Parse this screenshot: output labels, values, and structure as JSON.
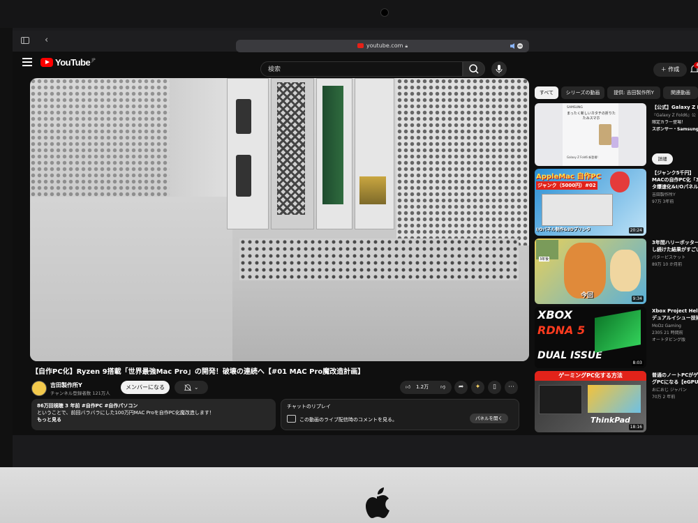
{
  "browser": {
    "url": "youtube.com"
  },
  "header": {
    "logo_text": "YouTube",
    "logo_sup": "JP",
    "search_placeholder": "検索",
    "create_label": "作成",
    "notification_count": "4"
  },
  "video": {
    "title": "【自作PC化】Ryzen 9搭載「世界最強Mac Pro」の開発！破壊の連続へ【#01 MAC Pro魔改造計画】",
    "channel_name": "吉田製作所Y",
    "subscribers": "チャンネル登録者数 121万人",
    "member_button": "メンバーになる",
    "like_count": "1.2万"
  },
  "description": {
    "stats": "86万回視聴  3 年前  #自作PC #自作パソコン",
    "line1": "ということで、前回バラバラにした100万円MAC Proを自作PC化魔改造します！",
    "more": "もっと見る"
  },
  "chat_replay": {
    "title": "チャットのリプレイ",
    "text": "この動画のライブ配信時のコメントを見る。",
    "open_button": "パネルを開く"
  },
  "sidebar": {
    "chips": [
      "すべて",
      "シリーズの動画",
      "提供: 吉田製作所Y",
      "関連動画"
    ],
    "recommendations": [
      {
        "title1": "【公式】Galaxy Z F",
        "title2": "『Galaxy Z Fold6』公",
        "meta1": "限定カラー登場！",
        "meta2": "スポンサー・Samsung",
        "thumb_text1": "SAMSUNG",
        "thumb_text2": "まったく新しいカタチの折りたたみスマホ",
        "thumb_text3": "Galaxy Z Fold6 新登場!",
        "action": "詳細"
      },
      {
        "title1": "【ジャンク5千円】",
        "title2": "MACの自作PC化「3",
        "meta1": "タ爆速化&I/Oパネル",
        "meta2": "吉田製作所Y",
        "meta3": "97万 3年前",
        "thumb_text1": "AppleMac 自作PC",
        "thumb_text2": "ジャンク（5000円）#02",
        "thumb_text3": "I/Oパネル制作&3Dプリンタ",
        "duration": "20:24"
      },
      {
        "title1": "3年間ハリーポッター",
        "title2": "し続けた結果がすごい",
        "meta1": "パターピスケット",
        "meta2": "89万 10 か月前",
        "thumb_text1": "今回",
        "thumb_text2": "3年後",
        "duration": "9:34"
      },
      {
        "title1": "Xbox Project HelixのRD",
        "title2": "デュアルイシュー技術",
        "meta1": "MoDz Gaming",
        "meta2": "2305 21 時間前",
        "meta3": "オートダビング版",
        "thumb_text1": "XBOX",
        "thumb_text2": "RDNA 5",
        "thumb_text3": "DUAL ISSUE",
        "duration": "8:03"
      },
      {
        "title1": "普通のノートPCがゲーミ",
        "title2": "グPCになる【eGPU】",
        "meta1": "おにおじ ジャパン",
        "meta2": "70万 2 年前",
        "thumb_text1": "ゲーミングPC化する方法",
        "thumb_text2": "ThinkPad",
        "duration": "18:16"
      }
    ]
  }
}
